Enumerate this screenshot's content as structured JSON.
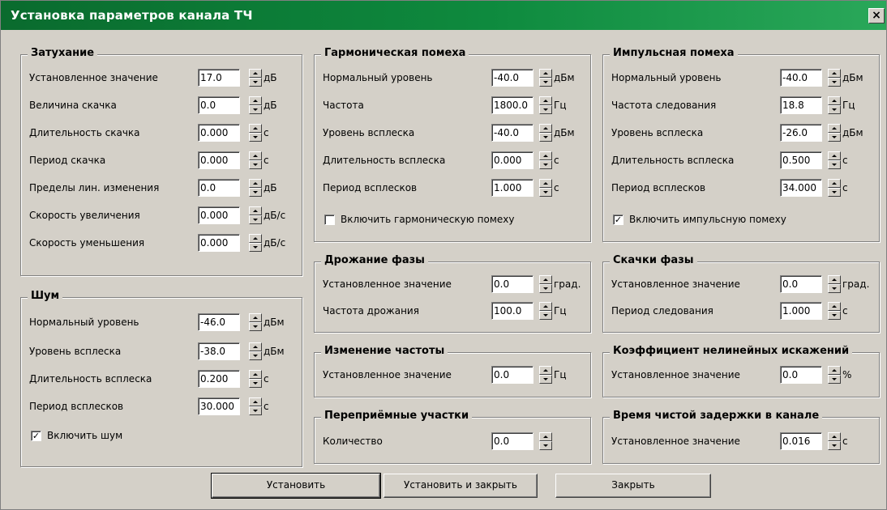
{
  "title": "Установка параметров канала ТЧ",
  "close_glyph": "×",
  "groups": {
    "atten": {
      "title": "Затухание",
      "rows": [
        {
          "label": "Установленное значение",
          "value": "17.0",
          "unit": "дБ"
        },
        {
          "label": "Величина скачка",
          "value": "0.0",
          "unit": "дБ"
        },
        {
          "label": "Длительность скачка",
          "value": "0.000",
          "unit": "с"
        },
        {
          "label": "Период скачка",
          "value": "0.000",
          "unit": "с"
        },
        {
          "label": "Пределы лин. изменения",
          "value": "0.0",
          "unit": "дБ"
        },
        {
          "label": "Скорость увеличения",
          "value": "0.000",
          "unit": "дБ/с"
        },
        {
          "label": "Скорость уменьшения",
          "value": "0.000",
          "unit": "дБ/с"
        }
      ]
    },
    "noise": {
      "title": "Шум",
      "rows": [
        {
          "label": "Нормальный уровень",
          "value": "-46.0",
          "unit": "дБм"
        },
        {
          "label": "Уровень всплеска",
          "value": "-38.0",
          "unit": "дБм"
        },
        {
          "label": "Длительность всплеска",
          "value": "0.200",
          "unit": "с"
        },
        {
          "label": "Период всплесков",
          "value": "30.000",
          "unit": "с"
        }
      ],
      "checkbox": {
        "label": "Включить шум",
        "checked": true,
        "mark": "✓"
      }
    },
    "harm": {
      "title": "Гармоническая помеха",
      "rows": [
        {
          "label": "Нормальный уровень",
          "value": "-40.0",
          "unit": "дБм"
        },
        {
          "label": "Частота",
          "value": "1800.0",
          "unit": "Гц"
        },
        {
          "label": "Уровень всплеска",
          "value": "-40.0",
          "unit": "дБм"
        },
        {
          "label": "Длительность всплеска",
          "value": "0.000",
          "unit": "с"
        },
        {
          "label": "Период всплесков",
          "value": "1.000",
          "unit": "с"
        }
      ],
      "checkbox": {
        "label": "Включить гармоническую помеху",
        "checked": false,
        "mark": ""
      }
    },
    "imp": {
      "title": "Импульсная помеха",
      "rows": [
        {
          "label": "Нормальный уровень",
          "value": "-40.0",
          "unit": "дБм"
        },
        {
          "label": "Частота следования",
          "value": "18.8",
          "unit": "Гц"
        },
        {
          "label": "Уровень всплеска",
          "value": "-26.0",
          "unit": "дБм"
        },
        {
          "label": "Длительность всплеска",
          "value": "0.500",
          "unit": "с"
        },
        {
          "label": "Период всплесков",
          "value": "34.000",
          "unit": "с"
        }
      ],
      "checkbox": {
        "label": "Включить импульсную помеху",
        "checked": true,
        "mark": "✓"
      }
    },
    "jitter": {
      "title": "Дрожание фазы",
      "rows": [
        {
          "label": "Установленное значение",
          "value": "0.0",
          "unit": "град."
        },
        {
          "label": "Частота дрожания",
          "value": "100.0",
          "unit": "Гц"
        }
      ]
    },
    "phasejump": {
      "title": "Скачки фазы",
      "rows": [
        {
          "label": "Установленное значение",
          "value": "0.0",
          "unit": "град."
        },
        {
          "label": "Период следования",
          "value": "1.000",
          "unit": "с"
        }
      ]
    },
    "freq": {
      "title": "Изменение частоты",
      "rows": [
        {
          "label": "Установленное значение",
          "value": "0.0",
          "unit": "Гц"
        }
      ]
    },
    "nonlin": {
      "title": "Коэффициент нелинейных искажений",
      "rows": [
        {
          "label": "Установленное значение",
          "value": "0.0",
          "unit": "%"
        }
      ]
    },
    "rerecv": {
      "title": "Переприёмные участки",
      "rows": [
        {
          "label": "Количество",
          "value": "0.0",
          "unit": ""
        }
      ]
    },
    "delay": {
      "title": "Время чистой задержки в канале",
      "rows": [
        {
          "label": "Установленное значение",
          "value": "0.016",
          "unit": "с"
        }
      ]
    }
  },
  "buttons": {
    "set": "Установить",
    "set_close": "Установить и закрыть",
    "close": "Закрыть"
  }
}
